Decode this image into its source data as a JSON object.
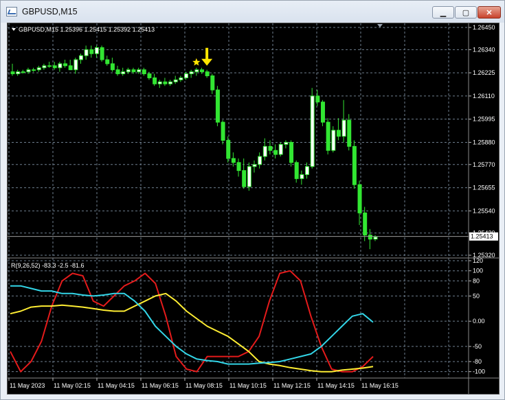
{
  "window": {
    "title": "GBPUSD,M15",
    "min_glyph": "▁",
    "max_glyph": "▢",
    "close_glyph": "✕"
  },
  "main_chart": {
    "header": "GBPUSD,M15  1.25396 1.25415 1.25392 1.25413",
    "price_ticks": [
      "1.26450",
      "1.26340",
      "1.26225",
      "1.26110",
      "1.25995",
      "1.25880",
      "1.25770",
      "1.25655",
      "1.25540",
      "1.25430",
      "1.25320"
    ],
    "current_price": "1.25413",
    "colors": {
      "bull": "#ffffff",
      "candle": "#32e632",
      "grid": "#6f7f8f",
      "marker": "#ffe600"
    }
  },
  "indicator": {
    "header": "R(9,26,52) -83.3 -2.5 -81.6",
    "ticks": [
      "120",
      "100",
      "80",
      "50",
      "0.00",
      "-50",
      "-80",
      "-100"
    ],
    "colors": {
      "fast": "#e51b1b",
      "mid": "#ffee33",
      "slow": "#33d6e8"
    }
  },
  "time_axis": [
    "11 May 2023",
    "11 May 02:15",
    "11 May 04:15",
    "11 May 06:15",
    "11 May 08:15",
    "11 May 10:15",
    "11 May 12:15",
    "11 May 14:15",
    "11 May 16:15"
  ],
  "chart_data": [
    {
      "type": "candlestick",
      "title": "GBPUSD,M15",
      "ylim": [
        1.2532,
        1.2645
      ],
      "candles_ohlc": [
        [
          1.2623,
          1.2627,
          1.2621,
          1.2622
        ],
        [
          1.2622,
          1.2624,
          1.2621,
          1.2623
        ],
        [
          1.2623,
          1.2624,
          1.2622,
          1.2623
        ],
        [
          1.2623,
          1.2625,
          1.2622,
          1.2624
        ],
        [
          1.2624,
          1.2625,
          1.2623,
          1.2624
        ],
        [
          1.2624,
          1.2626,
          1.2623,
          1.2625
        ],
        [
          1.2625,
          1.2627,
          1.2624,
          1.2626
        ],
        [
          1.2626,
          1.2628,
          1.2625,
          1.2626
        ],
        [
          1.2626,
          1.2628,
          1.2624,
          1.2625
        ],
        [
          1.2625,
          1.2628,
          1.2623,
          1.2627
        ],
        [
          1.2627,
          1.2629,
          1.2625,
          1.2626
        ],
        [
          1.2626,
          1.2629,
          1.2624,
          1.2624
        ],
        [
          1.2624,
          1.263,
          1.2622,
          1.2629
        ],
        [
          1.2629,
          1.2632,
          1.2627,
          1.2631
        ],
        [
          1.2631,
          1.2636,
          1.2629,
          1.2634
        ],
        [
          1.2634,
          1.2636,
          1.263,
          1.2632
        ],
        [
          1.2632,
          1.2636,
          1.263,
          1.2635
        ],
        [
          1.2635,
          1.2636,
          1.2628,
          1.2629
        ],
        [
          1.2629,
          1.2631,
          1.2626,
          1.2627
        ],
        [
          1.2627,
          1.263,
          1.2623,
          1.2624
        ],
        [
          1.2624,
          1.2626,
          1.2621,
          1.2622
        ],
        [
          1.2622,
          1.2625,
          1.2621,
          1.2623
        ],
        [
          1.2623,
          1.2625,
          1.2622,
          1.2624
        ],
        [
          1.2624,
          1.2625,
          1.2622,
          1.2623
        ],
        [
          1.2623,
          1.2625,
          1.2622,
          1.2624
        ],
        [
          1.2624,
          1.2625,
          1.2621,
          1.2622
        ],
        [
          1.2622,
          1.2623,
          1.2619,
          1.262
        ],
        [
          1.262,
          1.2622,
          1.2616,
          1.2617
        ],
        [
          1.2617,
          1.2619,
          1.2615,
          1.2618
        ],
        [
          1.2618,
          1.262,
          1.2616,
          1.2617
        ],
        [
          1.2617,
          1.2619,
          1.2616,
          1.2618
        ],
        [
          1.2618,
          1.2621,
          1.2617,
          1.2619
        ],
        [
          1.2619,
          1.2621,
          1.2618,
          1.262
        ],
        [
          1.262,
          1.2623,
          1.2619,
          1.2622
        ],
        [
          1.2622,
          1.2624,
          1.262,
          1.2623
        ],
        [
          1.2623,
          1.2625,
          1.2621,
          1.2624
        ],
        [
          1.2624,
          1.2625,
          1.2622,
          1.2623
        ],
        [
          1.2623,
          1.2624,
          1.262,
          1.2621
        ],
        [
          1.2621,
          1.2622,
          1.2612,
          1.2614
        ],
        [
          1.2614,
          1.2616,
          1.2596,
          1.2598
        ],
        [
          1.2598,
          1.2599,
          1.2587,
          1.2589
        ],
        [
          1.2589,
          1.2591,
          1.2578,
          1.258
        ],
        [
          1.258,
          1.2583,
          1.2576,
          1.2578
        ],
        [
          1.2578,
          1.258,
          1.2571,
          1.2574
        ],
        [
          1.2574,
          1.258,
          1.2565,
          1.2566
        ],
        [
          1.2566,
          1.2578,
          1.2564,
          1.2576
        ],
        [
          1.2576,
          1.2579,
          1.2573,
          1.2577
        ],
        [
          1.2577,
          1.2583,
          1.2575,
          1.2581
        ],
        [
          1.2581,
          1.259,
          1.2579,
          1.2586
        ],
        [
          1.2586,
          1.2589,
          1.2582,
          1.2584
        ],
        [
          1.2584,
          1.2587,
          1.258,
          1.2582
        ],
        [
          1.2582,
          1.2588,
          1.2581,
          1.2587
        ],
        [
          1.2587,
          1.2589,
          1.2585,
          1.2588
        ],
        [
          1.2588,
          1.2589,
          1.2576,
          1.2578
        ],
        [
          1.2578,
          1.2579,
          1.2568,
          1.257
        ],
        [
          1.257,
          1.2574,
          1.2567,
          1.2572
        ],
        [
          1.2572,
          1.2578,
          1.257,
          1.2576
        ],
        [
          1.2576,
          1.2615,
          1.2575,
          1.2611
        ],
        [
          1.2611,
          1.2614,
          1.2606,
          1.2608
        ],
        [
          1.2608,
          1.2609,
          1.2596,
          1.2598
        ],
        [
          1.2598,
          1.26,
          1.2582,
          1.2584
        ],
        [
          1.2584,
          1.2596,
          1.2583,
          1.2594
        ],
        [
          1.2594,
          1.26,
          1.2589,
          1.2591
        ],
        [
          1.2591,
          1.2609,
          1.2588,
          1.2599
        ],
        [
          1.2599,
          1.2602,
          1.2584,
          1.2586
        ],
        [
          1.2586,
          1.2589,
          1.2565,
          1.2567
        ],
        [
          1.2567,
          1.2569,
          1.2547,
          1.2553
        ],
        [
          1.2553,
          1.2556,
          1.2539,
          1.2542
        ],
        [
          1.2542,
          1.2545,
          1.2535,
          1.254
        ],
        [
          1.254,
          1.2542,
          1.2539,
          1.2541
        ]
      ],
      "markers": [
        {
          "type": "down-arrow",
          "candle_index": 37
        },
        {
          "type": "star",
          "candle_index": 35
        }
      ]
    },
    {
      "type": "line",
      "title": "R(9,26,52)",
      "ylim": [
        -110,
        120
      ],
      "x": [
        0,
        2,
        4,
        6,
        8,
        10,
        12,
        14,
        16,
        18,
        20,
        22,
        24,
        26,
        28,
        30,
        32,
        34,
        36,
        38,
        40,
        42,
        44,
        46,
        48,
        50,
        52,
        54,
        56,
        58,
        60,
        62,
        64,
        66,
        68,
        70
      ],
      "series": [
        {
          "name": "R(9)",
          "values": [
            -60,
            -100,
            -80,
            -40,
            30,
            80,
            95,
            90,
            40,
            30,
            50,
            70,
            80,
            95,
            75,
            10,
            -70,
            -95,
            -100,
            -70,
            -70,
            -70,
            -70,
            -60,
            -30,
            40,
            95,
            100,
            80,
            10,
            -50,
            -95,
            -100,
            -100,
            -90,
            -70
          ]
        },
        {
          "name": "R(26)",
          "values": [
            15,
            20,
            28,
            30,
            30,
            32,
            30,
            28,
            25,
            22,
            20,
            20,
            30,
            40,
            50,
            55,
            40,
            20,
            5,
            -10,
            -20,
            -30,
            -45,
            -60,
            -80,
            -85,
            -88,
            -92,
            -95,
            -98,
            -100,
            -100,
            -97,
            -95,
            -93,
            -90
          ]
        },
        {
          "name": "R(52)",
          "values": [
            70,
            70,
            65,
            60,
            60,
            55,
            55,
            52,
            50,
            52,
            55,
            55,
            40,
            20,
            -10,
            -30,
            -50,
            -65,
            -75,
            -78,
            -80,
            -85,
            -85,
            -85,
            -83,
            -82,
            -80,
            -75,
            -70,
            -65,
            -50,
            -30,
            -10,
            10,
            15,
            -2
          ]
        }
      ]
    }
  ]
}
